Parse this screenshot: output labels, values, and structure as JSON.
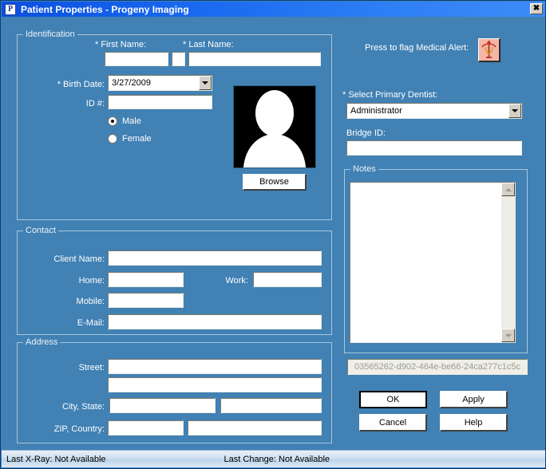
{
  "window": {
    "title": "Patient Properties - Progeny Imaging",
    "icon": "app-icon",
    "close_label": "✖"
  },
  "identification": {
    "legend": "Identification",
    "first_name": {
      "label": "* First Name:",
      "value": ""
    },
    "middle_initial": {
      "label": "",
      "value": ""
    },
    "last_name": {
      "label": "* Last Name:",
      "value": ""
    },
    "birth_date": {
      "label": "* Birth Date:",
      "value": "3/27/2009"
    },
    "id_number": {
      "label": "ID #:",
      "value": ""
    },
    "gender": {
      "male": {
        "label": "Male",
        "selected": true
      },
      "female": {
        "label": "Female",
        "selected": false
      }
    },
    "photo": {
      "name": "patient-photo-placeholder"
    },
    "browse_label": "Browse"
  },
  "medical_alert": {
    "label": "Press to flag Medical Alert:",
    "icon": "caduceus-icon"
  },
  "dentist": {
    "label": "* Select Primary Dentist:",
    "value": "Administrator",
    "options": [
      "Administrator"
    ]
  },
  "bridge": {
    "label": "Bridge ID:",
    "value": ""
  },
  "notes": {
    "legend": "Notes",
    "value": "",
    "scroll_up": "▲",
    "scroll_down": "▼"
  },
  "patient_guid": "03565262-d902-464e-be66-24ca277c1c5c",
  "contact": {
    "legend": "Contact",
    "client_name": {
      "label": "Client Name:",
      "value": ""
    },
    "home": {
      "label": "Home:",
      "value": ""
    },
    "work": {
      "label": "Work:",
      "value": ""
    },
    "mobile": {
      "label": "Mobile:",
      "value": ""
    },
    "email": {
      "label": "E-Mail:",
      "value": ""
    }
  },
  "address": {
    "legend": "Address",
    "street": {
      "label": "Street:",
      "value": ""
    },
    "street2": {
      "label": "",
      "value": ""
    },
    "city_state": {
      "label": "City, State:",
      "city": "",
      "state": ""
    },
    "zip_country": {
      "label": "ZIP, Country:",
      "zip": "",
      "country": ""
    }
  },
  "buttons": {
    "ok": "OK",
    "apply": "Apply",
    "cancel": "Cancel",
    "help": "Help"
  },
  "statusbar": {
    "last_xray": "Last X-Ray:  Not Available",
    "last_change": "Last Change:  Not Available"
  },
  "colors": {
    "dialog_bg": "#4181b4",
    "titlebar_start": "#0a4fe0",
    "titlebar_end": "#3e8cf8",
    "field_bg": "#ffffff",
    "statusbar_bg": "#cfe0f0",
    "alert_bg": "#f4b6a6"
  }
}
